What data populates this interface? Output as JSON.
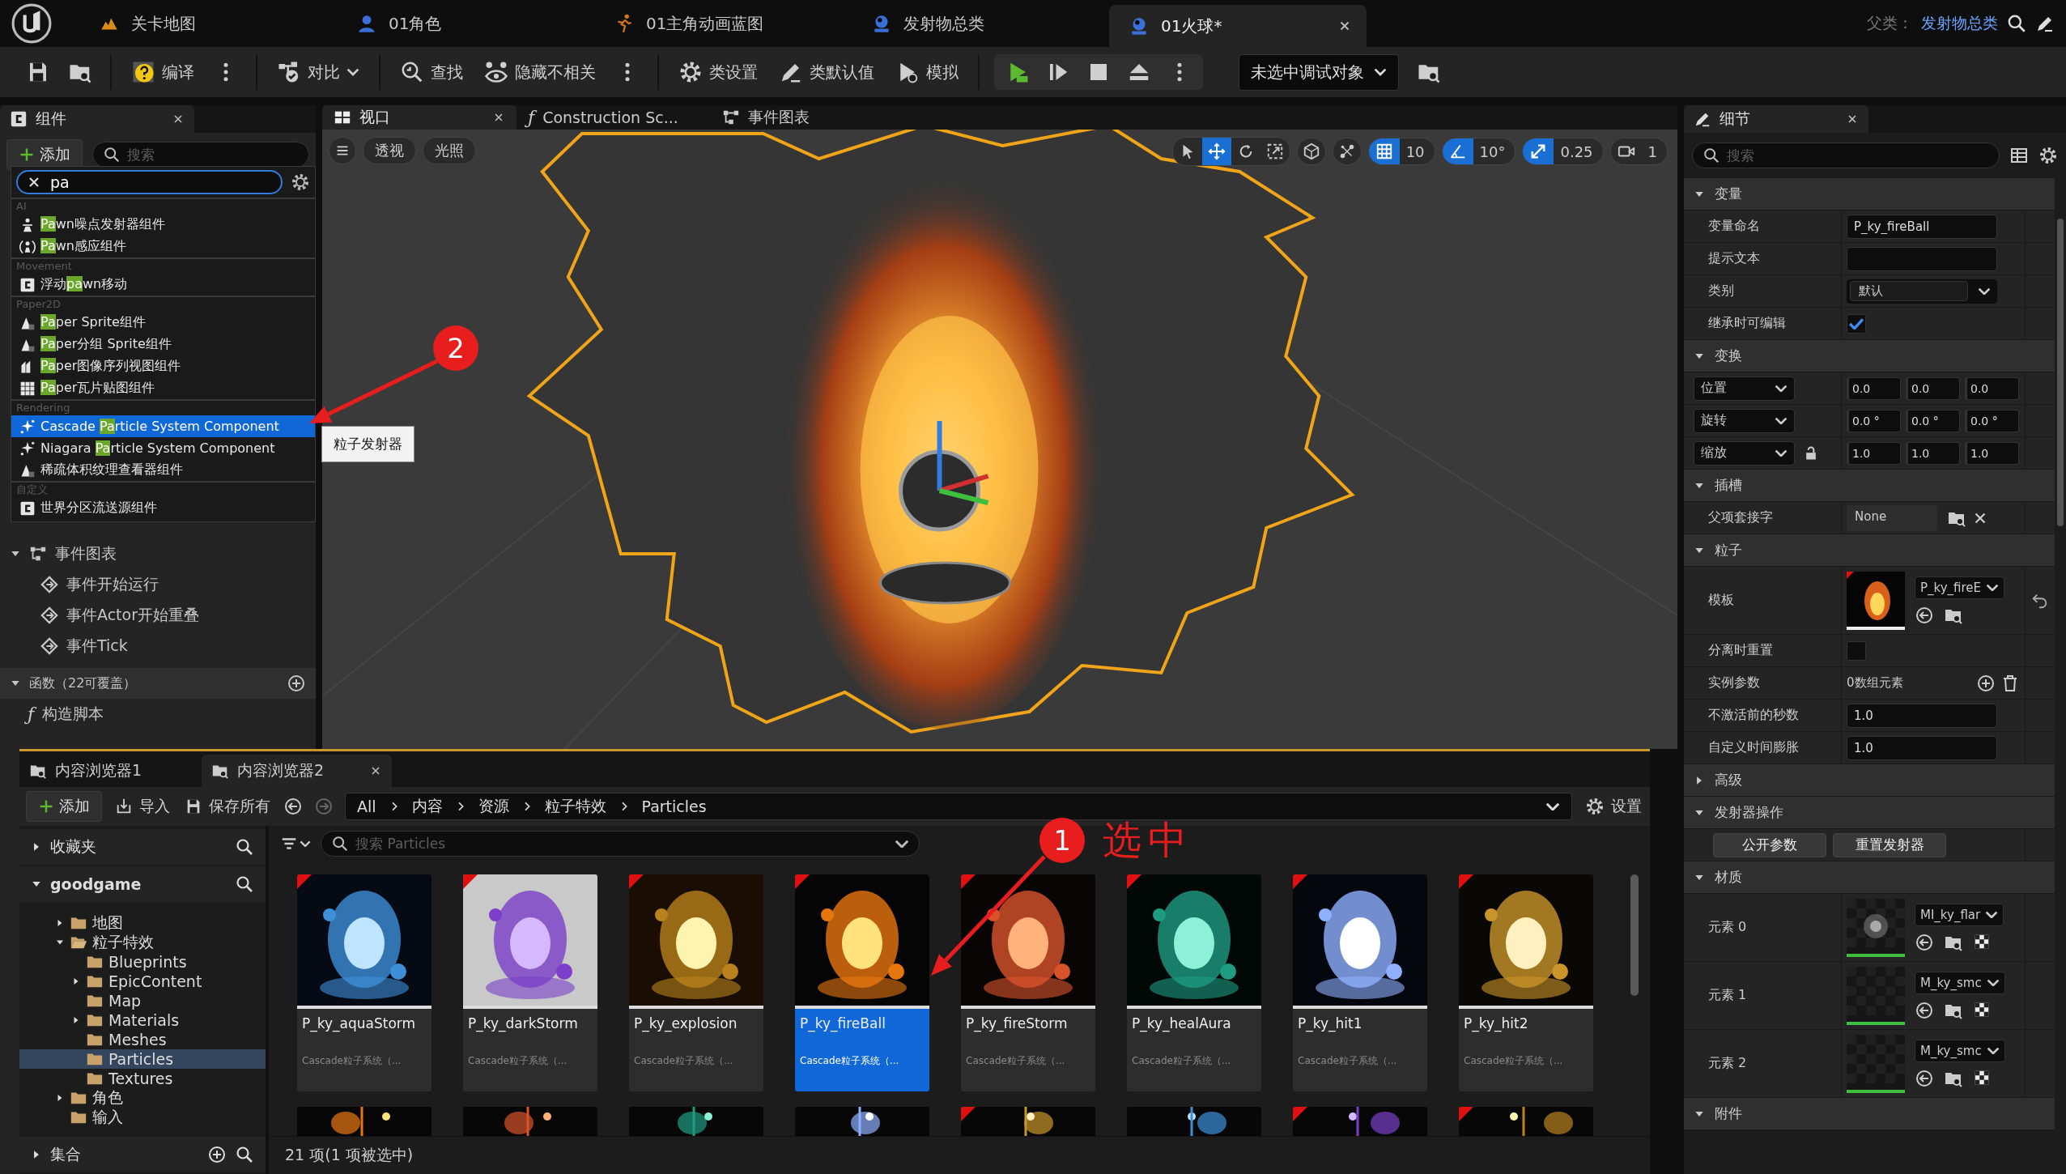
{
  "app_tabs": [
    {
      "label": "关卡地图",
      "kind": "level",
      "selected": false
    },
    {
      "label": "01角色",
      "kind": "character",
      "selected": false
    },
    {
      "label": "01主角动画蓝图",
      "kind": "animation",
      "selected": false
    },
    {
      "label": "发射物总类",
      "kind": "class",
      "selected": false
    },
    {
      "label": "01火球*",
      "kind": "class",
      "selected": true
    }
  ],
  "parent_class": {
    "label": "父类：",
    "value": "发射物总类"
  },
  "toolbar": [
    {
      "kind": "group",
      "items": [
        {
          "kind": "save"
        },
        {
          "kind": "browse"
        }
      ]
    },
    {
      "kind": "group",
      "items": [
        {
          "kind": "compile",
          "label": "编译"
        },
        {
          "kind": "more"
        }
      ]
    },
    {
      "kind": "group",
      "items": [
        {
          "kind": "diff",
          "label": "对比"
        }
      ]
    },
    {
      "kind": "group",
      "items": [
        {
          "kind": "find",
          "label": "查找"
        },
        {
          "kind": "hide",
          "label": "隐藏不相关"
        },
        {
          "kind": "more"
        }
      ]
    },
    {
      "kind": "group",
      "items": [
        {
          "kind": "class_settings",
          "label": "类设置"
        },
        {
          "kind": "class_defaults",
          "label": "类默认值"
        },
        {
          "kind": "simulate",
          "label": "模拟"
        }
      ]
    },
    {
      "kind": "play_controls",
      "items": [
        {
          "kind": "play"
        },
        {
          "kind": "step"
        },
        {
          "kind": "stop"
        },
        {
          "kind": "eject"
        },
        {
          "kind": "more"
        }
      ]
    },
    {
      "kind": "group",
      "items": [
        {
          "kind": "debug_object",
          "label": "未选中调试对象"
        },
        {
          "kind": "browse"
        }
      ]
    }
  ],
  "components_panel": {
    "title": "组件",
    "add_label": "添加",
    "search_placeholder": "搜索"
  },
  "add_menu": {
    "query": "pa",
    "categories": [
      {
        "title": "AI",
        "items": [
          {
            "kind": "figure",
            "match": "Pa",
            "after": "wn噪点发射器组件",
            "selected": false
          },
          {
            "kind": "sense",
            "match": "Pa",
            "after": "wn感应组件",
            "selected": false
          }
        ]
      },
      {
        "title": "Movement",
        "items": [
          {
            "kind": "component",
            "before": "浮动",
            "match": "pa",
            "after": "wn移动",
            "selected": false
          }
        ]
      },
      {
        "title": "Paper2D",
        "items": [
          {
            "kind": "sprite",
            "match": "Pa",
            "after": "per Sprite组件",
            "selected": false
          },
          {
            "kind": "sprite",
            "match": "Pa",
            "after": "per分组 Sprite组件",
            "selected": false
          },
          {
            "kind": "flipbook",
            "match": "Pa",
            "after": "per图像序列视图组件",
            "selected": false
          },
          {
            "kind": "tiles",
            "match": "Pa",
            "after": "per瓦片贴图组件",
            "selected": false
          }
        ]
      },
      {
        "title": "Rendering",
        "items": [
          {
            "kind": "particle",
            "before": "Cascade ",
            "match": "Pa",
            "after": "rticle System Component",
            "selected": true
          },
          {
            "kind": "particle",
            "before": "Niagara ",
            "match": "Pa",
            "after": "rticle System Component",
            "selected": false
          },
          {
            "kind": "sprite",
            "before": "稀疏体积纹理查看器组件",
            "selected": false
          }
        ]
      },
      {
        "title": "自定义",
        "items": [
          {
            "kind": "component",
            "before": "世界分区流送源组件",
            "selected": false
          }
        ]
      }
    ]
  },
  "tooltip": "粒子发射器",
  "graph_tree": [
    {
      "label": "事件图表",
      "kind": "events",
      "expanded": true,
      "children": [
        {
          "label": "事件开始运行",
          "kind": "event"
        },
        {
          "label": "事件Actor开始重叠",
          "kind": "event"
        },
        {
          "label": "事件Tick",
          "kind": "event"
        }
      ]
    },
    {
      "label": "函数（22可覆盖）",
      "kind": "functions",
      "expanded": true,
      "children": [
        {
          "label": "构造脚本",
          "kind": "function",
          "glyph": "ƒ"
        }
      ]
    }
  ],
  "viewport_tabs": [
    {
      "label": "视口",
      "kind": "viewport",
      "selected": true
    },
    {
      "label": "Construction Sc...",
      "kind": "script",
      "glyph": "ƒ",
      "selected": false
    },
    {
      "label": "事件图表",
      "kind": "graph",
      "selected": false
    }
  ],
  "viewport": {
    "view_buttons": [
      "透视",
      "光照"
    ],
    "transform_tools": [
      {
        "kind": "select",
        "selected": false
      },
      {
        "kind": "move",
        "selected": true
      },
      {
        "kind": "rotate",
        "selected": false
      },
      {
        "kind": "scale",
        "selected": false
      }
    ],
    "tools": [
      {
        "kind": "world"
      },
      {
        "kind": "surface"
      }
    ],
    "snaps": [
      {
        "kind": "grid",
        "value": "10",
        "on": true
      },
      {
        "kind": "angle",
        "value": "10°",
        "on": true
      },
      {
        "kind": "scale",
        "value": "0.25",
        "on": true
      },
      {
        "kind": "camera",
        "value": "1",
        "on": false
      }
    ]
  },
  "details": {
    "title": "细节",
    "search_placeholder": "搜索",
    "sections": [
      {
        "title": "变量",
        "expanded": true,
        "rows": [
          {
            "kind": "text",
            "label": "变量命名",
            "value": "P_ky_fireBall"
          },
          {
            "kind": "text",
            "label": "提示文本"
          },
          {
            "kind": "dropdown",
            "label": "类别",
            "value": "默认"
          },
          {
            "kind": "checkbox",
            "label": "继承时可编辑",
            "checked": true
          }
        ]
      },
      {
        "title": "变换",
        "expanded": true,
        "rows": [
          {
            "kind": "vector",
            "label": "位置",
            "values": [
              "0.0",
              "0.0",
              "0.0"
            ]
          },
          {
            "kind": "vector",
            "label": "旋转",
            "values": [
              "0.0 °",
              "0.0 °",
              "0.0 °"
            ]
          },
          {
            "kind": "vector",
            "label": "缩放",
            "values": [
              "1.0",
              "1.0",
              "1.0"
            ],
            "locked": false
          }
        ]
      },
      {
        "title": "插槽",
        "expanded": true,
        "rows": [
          {
            "kind": "asset",
            "label": "父项套接字",
            "value": "None"
          }
        ]
      },
      {
        "title": "粒子",
        "expanded": true,
        "rows": [
          {
            "kind": "template",
            "label": "模板",
            "value": "P_ky_fireE",
            "reset": true
          },
          {
            "kind": "checkbox",
            "label": "分离时重置",
            "checked": false
          },
          {
            "kind": "array",
            "label": "实例参数",
            "value": "0数组元素"
          },
          {
            "kind": "text",
            "label": "不激活前的秒数",
            "value": "1.0"
          },
          {
            "kind": "text",
            "label": "自定义时间膨胀",
            "value": "1.0"
          }
        ]
      },
      {
        "title": "高级",
        "expanded": false
      },
      {
        "title": "发射器操作",
        "expanded": true,
        "rows": [
          {
            "kind": "buttons",
            "buttons": [
              "公开参数",
              "重置发射器"
            ]
          }
        ]
      },
      {
        "title": "材质",
        "expanded": true,
        "rows": [
          {
            "kind": "material",
            "label": "元素 0",
            "value": "MI_ky_flar"
          },
          {
            "kind": "material",
            "label": "元素 1",
            "value": "M_ky_smc"
          },
          {
            "kind": "material",
            "label": "元素 2",
            "value": "M_ky_smc"
          }
        ]
      },
      {
        "title": "附件",
        "expanded": true
      }
    ]
  },
  "content_browser": {
    "tabs": [
      {
        "label": "内容浏览器1",
        "selected": false
      },
      {
        "label": "内容浏览器2",
        "selected": true
      }
    ],
    "add_label": "添加",
    "import_label": "导入",
    "save_all_label": "保存所有",
    "path": [
      "All",
      "内容",
      "资源",
      "粒子特效",
      "Particles"
    ],
    "settings_label": "设置",
    "favorites": {
      "label": "收藏夹",
      "expanded": false
    },
    "project": {
      "label": "goodgame",
      "expanded": true
    },
    "folders": [
      {
        "label": "地图",
        "has_children": true,
        "expanded": false,
        "selected": false
      },
      {
        "label": "粒子特效",
        "has_children": true,
        "expanded": true,
        "selected": false,
        "children": [
          {
            "label": "Blueprints",
            "has_children": false,
            "selected": false
          },
          {
            "label": "EpicContent",
            "has_children": true,
            "expanded": false,
            "selected": false
          },
          {
            "label": "Map",
            "has_children": false,
            "selected": false
          },
          {
            "label": "Materials",
            "has_children": true,
            "expanded": false,
            "selected": false
          },
          {
            "label": "Meshes",
            "has_children": false,
            "selected": false
          },
          {
            "label": "Particles",
            "has_children": false,
            "selected": true
          },
          {
            "label": "Textures",
            "has_children": false,
            "selected": false
          }
        ]
      },
      {
        "label": "角色",
        "has_children": true,
        "expanded": false,
        "selected": false
      },
      {
        "label": "输入",
        "has_children": false,
        "selected": false
      }
    ],
    "collections": {
      "label": "集合",
      "expanded": false
    },
    "search_placeholder": "搜索 Particles",
    "assets": [
      {
        "name": "P_ky_aquaStorm",
        "type": "Cascade粒子系统（...",
        "selected": false,
        "modified": true
      },
      {
        "name": "P_ky_darkStorm",
        "type": "Cascade粒子系统（...",
        "selected": false,
        "modified": true
      },
      {
        "name": "P_ky_explosion",
        "type": "Cascade粒子系统（...",
        "selected": false,
        "modified": true
      },
      {
        "name": "P_ky_fireBall",
        "type": "Cascade粒子系统（...",
        "selected": true,
        "modified": true
      },
      {
        "name": "P_ky_fireStorm",
        "type": "Cascade粒子系统（...",
        "selected": false,
        "modified": true
      },
      {
        "name": "P_ky_healAura",
        "type": "Cascade粒子系统（...",
        "selected": false,
        "modified": true
      },
      {
        "name": "P_ky_hit1",
        "type": "Cascade粒子系统（...",
        "selected": false,
        "modified": true
      },
      {
        "name": "P_ky_hit2",
        "type": "Cascade粒子系统（...",
        "selected": false,
        "modified": true
      }
    ],
    "more_assets": [
      {
        "modified": false
      },
      {
        "modified": false
      },
      {
        "modified": false
      },
      {
        "modified": false
      },
      {
        "modified": true
      },
      {
        "modified": false
      },
      {
        "modified": true
      },
      {
        "modified": true
      }
    ],
    "status": "21 项(1 项被选中)"
  },
  "annotations": [
    {
      "kind": "marker",
      "label": "2"
    },
    {
      "kind": "marker",
      "label": "1"
    },
    {
      "kind": "caption",
      "label": "选中"
    }
  ]
}
